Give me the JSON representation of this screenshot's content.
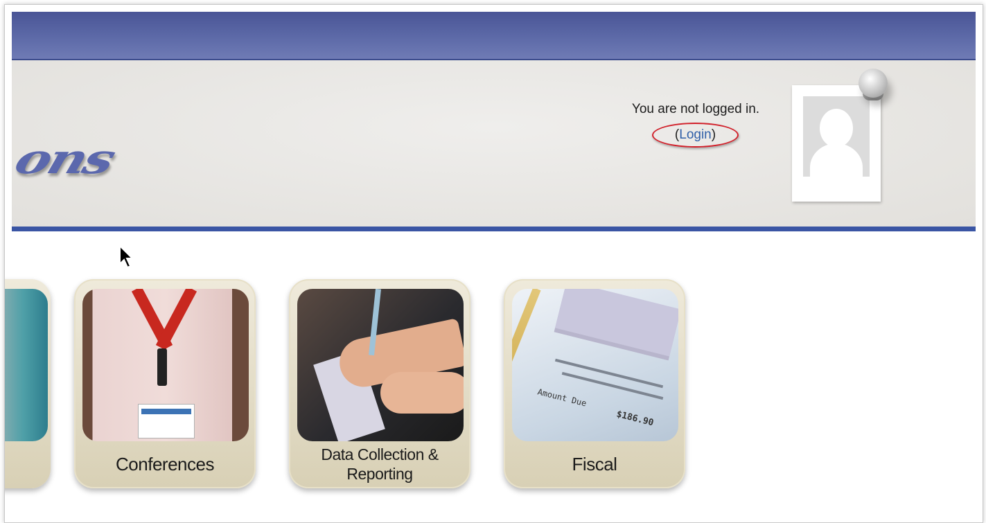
{
  "header": {
    "logo_fragment": "ons",
    "login_status": "You are not logged in.",
    "login_open_paren": "(",
    "login_link": "Login",
    "login_close_paren": ")"
  },
  "tiles": [
    {
      "label": "Conferences",
      "image": "conference-attendee-lanyard"
    },
    {
      "label_line1": "Data Collection &",
      "label_line2": "Reporting",
      "image": "hands-with-pen-and-paper"
    },
    {
      "label": "Fiscal",
      "image": "pencil-and-financial-statement"
    }
  ],
  "fiscal_image_text": {
    "amount_due_label": "Amount Due",
    "amount": "$186.90"
  },
  "colors": {
    "top_bar": "#4a5596",
    "header_rule": "#3a55a4",
    "login_link": "#2f5fa8",
    "highlight_oval": "#d2202a",
    "tile_bg": "#e5dec7"
  },
  "icons": [
    "avatar-placeholder-icon",
    "pushpin-icon",
    "mouse-cursor-icon"
  ]
}
